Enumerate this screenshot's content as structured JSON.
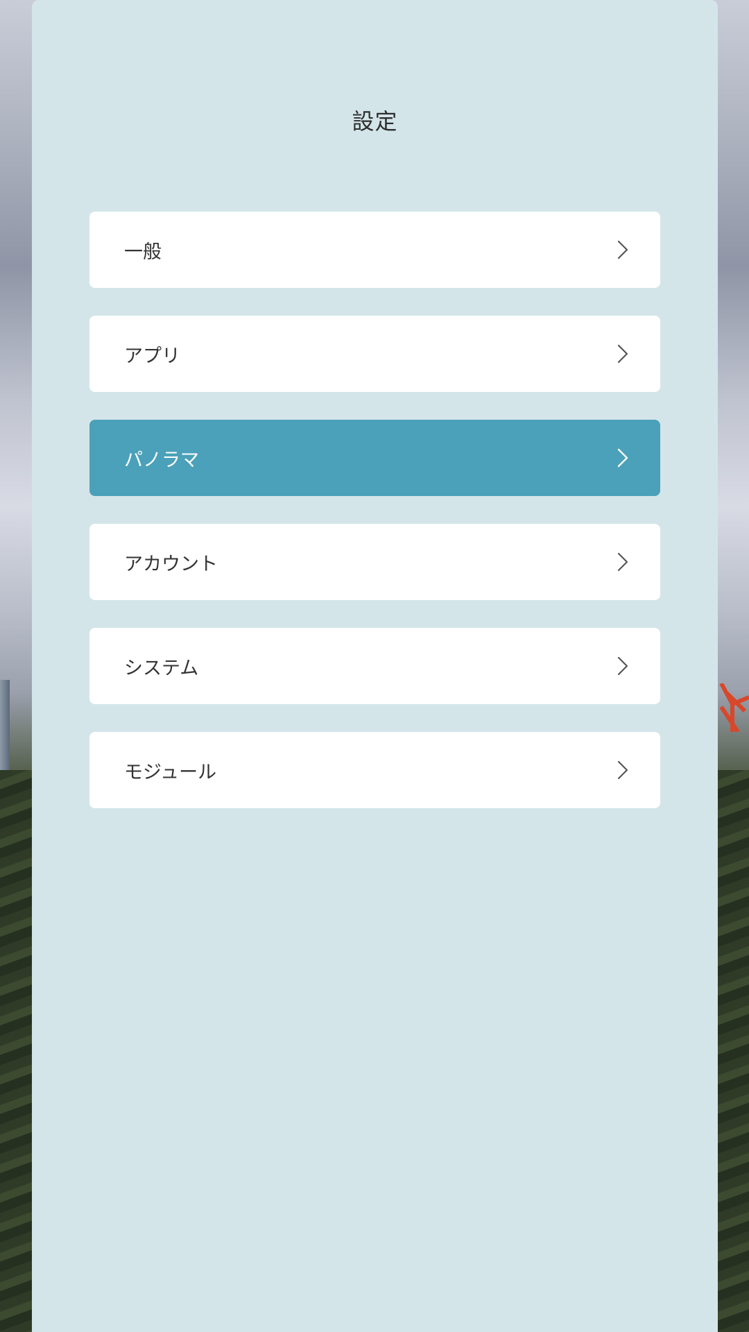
{
  "header": {
    "title": "設定"
  },
  "menu": {
    "items": [
      {
        "label": "一般",
        "active": false
      },
      {
        "label": "アプリ",
        "active": false
      },
      {
        "label": "パノラマ",
        "active": true
      },
      {
        "label": "アカウント",
        "active": false
      },
      {
        "label": "システム",
        "active": false
      },
      {
        "label": "モジュール",
        "active": false
      }
    ]
  },
  "icons": {
    "chevron": "chevron-right-icon"
  },
  "colors": {
    "panel_background": "#d4e5ea",
    "item_background": "#ffffff",
    "active_background": "#4aa1b9",
    "active_text": "#ffffff",
    "text": "#333333",
    "chevron": "#555555",
    "active_chevron": "#ffffff"
  }
}
